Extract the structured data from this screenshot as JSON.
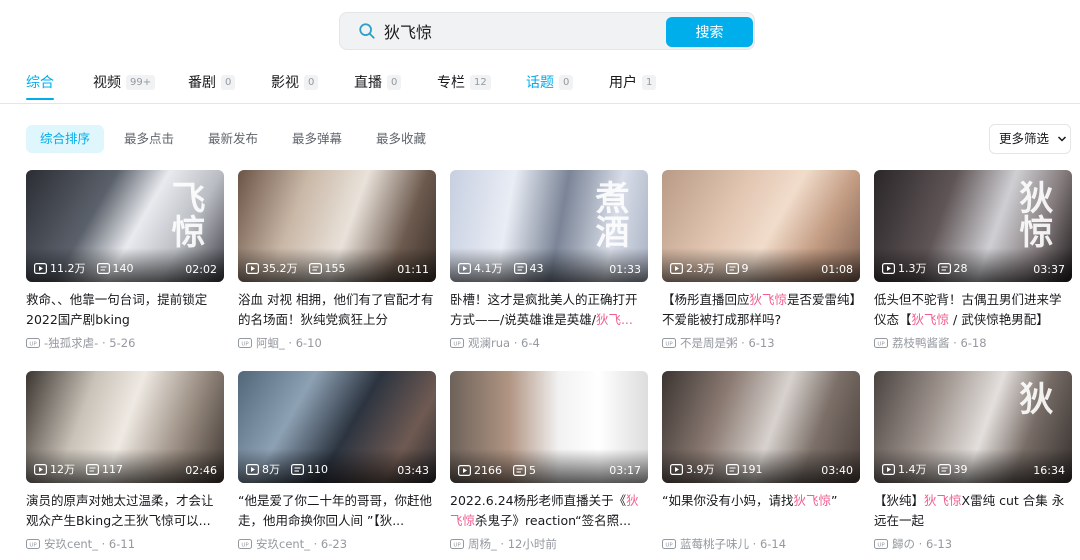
{
  "search": {
    "value": "狄飞惊",
    "button_label": "搜索"
  },
  "tabs": [
    {
      "label": "综合",
      "count": ""
    },
    {
      "label": "视频",
      "count": "99+"
    },
    {
      "label": "番剧",
      "count": "0"
    },
    {
      "label": "影视",
      "count": "0"
    },
    {
      "label": "直播",
      "count": "0"
    },
    {
      "label": "专栏",
      "count": "12"
    },
    {
      "label": "话题",
      "count": "0"
    },
    {
      "label": "用户",
      "count": "1"
    }
  ],
  "sort": [
    "综合排序",
    "最多点击",
    "最新发布",
    "最多弹幕",
    "最多收藏"
  ],
  "more_filter": "更多筛选",
  "highlight_color": "#f25d8e",
  "accent_color": "#00aeec",
  "videos": [
    {
      "views": "11.2万",
      "danmaku": "140",
      "duration": "02:02",
      "title_a": "救命、、他靠一句台词，提前锁定2022国产剧bking",
      "title_hl": "",
      "title_b": "",
      "author": "-独孤求虐-",
      "date": "5-26",
      "overlay": "飞惊"
    },
    {
      "views": "35.2万",
      "danmaku": "155",
      "duration": "01:11",
      "title_a": "浴血 对视 相拥，他们有了官配才有的名场面！狄纯党疯狂上分",
      "title_hl": "",
      "title_b": "",
      "author": "阿蛔_",
      "date": "6-10",
      "overlay": ""
    },
    {
      "views": "4.1万",
      "danmaku": "43",
      "duration": "01:33",
      "title_a": "卧槽！这才是疯批美人的正确打开方式——/说英雄谁是英雄/",
      "title_hl": "狄飞...",
      "title_b": "",
      "author": "观澜rua",
      "date": "6-4",
      "overlay": "煮酒"
    },
    {
      "views": "2.3万",
      "danmaku": "9",
      "duration": "01:08",
      "title_a": "【杨彤直播回应",
      "title_hl": "狄飞惊",
      "title_b": "是否爱雷纯】不爱能被打成那样吗?",
      "author": "不是周是粥",
      "date": "6-13",
      "overlay": ""
    },
    {
      "views": "1.3万",
      "danmaku": "28",
      "duration": "03:37",
      "title_a": "低头但不驼背！古偶丑男们进来学仪态【",
      "title_hl": "狄飞惊",
      "title_b": " / 武侠惊艳男配】",
      "author": "荔枝鸭酱酱",
      "date": "6-18",
      "overlay": "狄惊"
    },
    {
      "views": "12万",
      "danmaku": "117",
      "duration": "02:46",
      "title_a": "演员的原声对她太过温柔，才会让观众产生Bking之王狄飞惊可以...",
      "title_hl": "",
      "title_b": "",
      "author": "安玖cent_",
      "date": "6-11",
      "overlay": ""
    },
    {
      "views": "8万",
      "danmaku": "110",
      "duration": "03:43",
      "title_a": "“他是爱了你二十年的哥哥，你赶他走，他用命换你回人间 ”【狄...",
      "title_hl": "",
      "title_b": "",
      "author": "安玖cent_",
      "date": "6-23",
      "overlay": ""
    },
    {
      "views": "2166",
      "danmaku": "5",
      "duration": "03:17",
      "title_a": "2022.6.24杨彤老师直播关于《",
      "title_hl": "狄飞惊",
      "title_b": "杀鬼子》reaction“签名照...",
      "author": "周杨_",
      "date": "12小时前",
      "overlay": ""
    },
    {
      "views": "3.9万",
      "danmaku": "191",
      "duration": "03:40",
      "title_a": "“如果你没有小妈，请找",
      "title_hl": "狄飞惊",
      "title_b": "”",
      "author": "蓝莓桃子味儿",
      "date": "6-14",
      "overlay": ""
    },
    {
      "views": "1.4万",
      "danmaku": "39",
      "duration": "16:34",
      "title_a": "【狄纯】",
      "title_hl": "狄飞惊",
      "title_b": "X雷纯 cut 合集 永远在一起",
      "author": "歸の",
      "date": "6-13",
      "overlay": "狄"
    }
  ]
}
